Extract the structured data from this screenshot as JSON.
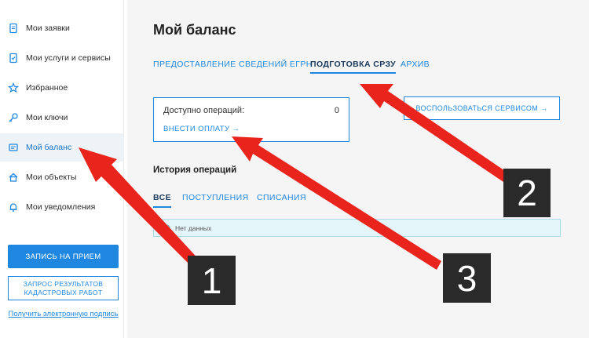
{
  "sidebar": {
    "items": [
      {
        "label": "Мои заявки",
        "icon": "document-icon"
      },
      {
        "label": "Мои услуги и сервисы",
        "icon": "checklist-icon"
      },
      {
        "label": "Избранное",
        "icon": "star-icon"
      },
      {
        "label": "Мои ключи",
        "icon": "key-icon"
      },
      {
        "label": "Мой баланс",
        "icon": "wallet-icon"
      },
      {
        "label": "Мои объекты",
        "icon": "home-icon"
      },
      {
        "label": "Мои уведомления",
        "icon": "bell-icon"
      }
    ],
    "active_index": 4,
    "appointment_button": "ЗАПИСЬ НА ПРИЕМ",
    "cadastral_button": "ЗАПРОС РЕЗУЛЬТАТОВ\nКАДАСТРОВЫХ РАБОТ",
    "signature_link": "Получить электронную подпись"
  },
  "main": {
    "title": "Мой баланс",
    "tabs": [
      {
        "label": "ПРЕДОСТАВЛЕНИЕ СВЕДЕНИЙ ЕГРН"
      },
      {
        "label": "ПОДГОТОВКА СРЗУ"
      },
      {
        "label": "АРХИВ"
      }
    ],
    "active_tab": 1,
    "balance": {
      "label": "Доступно операций:",
      "value": "0",
      "pay_link": "ВНЕСТИ ОПЛАТУ →"
    },
    "service_button": "ВОСПОЛЬЗОВАТЬСЯ СЕРВИСОМ →",
    "history": {
      "title": "История операций",
      "filters": [
        {
          "label": "ВСЕ"
        },
        {
          "label": "ПОСТУПЛЕНИЯ"
        },
        {
          "label": "СПИСАНИЯ"
        }
      ],
      "empty_text": "Нет данных"
    }
  },
  "annotations": {
    "labels": [
      "1",
      "2",
      "3"
    ],
    "arrow_color": "#e8241c",
    "box_color": "#2a2a2a"
  },
  "colors": {
    "accent": "#1f87e0",
    "sidebar_active_bg": "#eef3f8",
    "content_bg": "#f5f5f5",
    "info_bg": "#e4f5fa"
  }
}
